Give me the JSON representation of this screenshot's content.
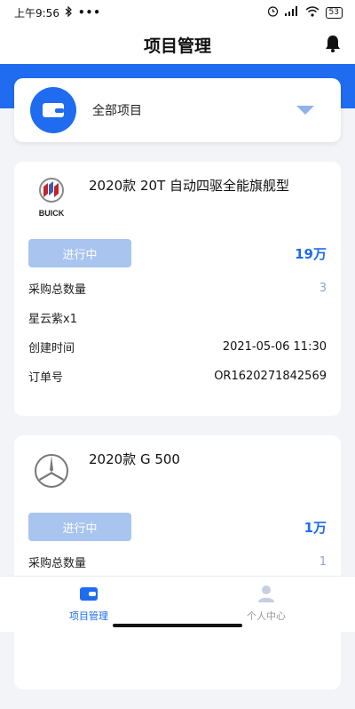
{
  "status_bar": {
    "time": "上午9:56",
    "battery": "53"
  },
  "header": {
    "title": "项目管理"
  },
  "selector": {
    "label": "全部项目"
  },
  "cards": [
    {
      "brand": "BUICK",
      "model": "2020款 20T 自动四驱全能旗舰型",
      "status": "进行中",
      "price": "19万",
      "qty_label": "采购总数量",
      "qty_value": "3",
      "color_item": "星云紫x1",
      "created_label": "创建时间",
      "created_value": "2021-05-06 11:30",
      "order_label": "订单号",
      "order_value": "OR1620271842569"
    },
    {
      "model": "2020款 G 500",
      "status": "进行中",
      "price": "1万",
      "qty_label": "采购总数量",
      "qty_value": "1"
    }
  ],
  "tabs": [
    {
      "label": "项目管理",
      "active": true
    },
    {
      "label": "个人中心",
      "active": false
    }
  ],
  "colors": {
    "accent": "#1f6cf0",
    "status_button": "#a8c4ef",
    "background": "#f2f4f7"
  }
}
